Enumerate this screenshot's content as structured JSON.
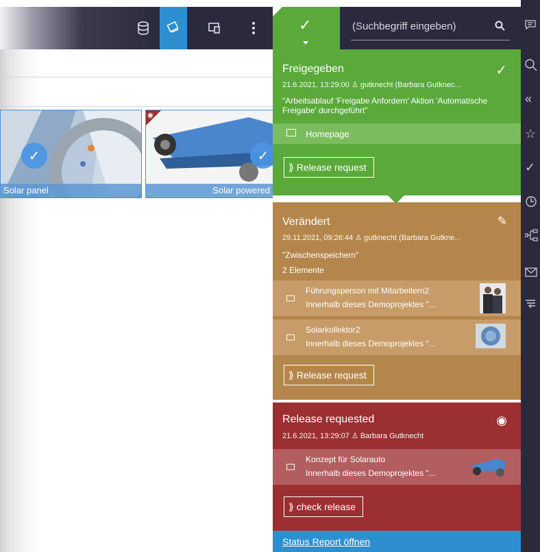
{
  "toolbar": {
    "icons": [
      "database-icon",
      "sync-icon",
      "devices-icon",
      "more-vertical-icon"
    ]
  },
  "search": {
    "placeholder": "(Suchbegriff eingeben)",
    "icon": "search-icon"
  },
  "thumbnails": [
    {
      "caption": "Solar panel",
      "selected": true
    },
    {
      "caption": "Solar powered",
      "selected": true
    }
  ],
  "status_panel": {
    "approved": {
      "title": "Freigegeben",
      "meta": "21.6.2021, 13:29:00",
      "user": "gutknecht (Barbara Gutknec...",
      "note": "\"Arbeitsablauf 'Freigabe Anfordern' Aktion 'Automatische Freigabe' durchgeführt\"",
      "folder": "Homepage",
      "button": "Release request",
      "color": "#5aa93a"
    },
    "changed": {
      "title": "Verändert",
      "meta": "29.11.2021, 09:26:44",
      "user": "gutknecht (Barbara Gutkne...",
      "note": "\"Zwischenspeichern\"",
      "count": "2 Elemente",
      "items": [
        {
          "name": "Führungsperson mit Mitarbeitern2",
          "desc": "Innerhalb dieses Demoprojektes \"..."
        },
        {
          "name": "Solarkollektor2",
          "desc": "Innerhalb dieses Demoprojektes \"..."
        }
      ],
      "button": "Release request",
      "color": "#b5864b"
    },
    "requested": {
      "title": "Release requested",
      "meta": "21.6.2021, 13:29:07",
      "user": "Barbara Gutknecht",
      "items": [
        {
          "name": "Konzept für Solarauto",
          "desc": "Innerhalb dieses Demoprojektes \"..."
        }
      ],
      "button": "check release",
      "color": "#9b2f31"
    },
    "footer_link": "Status Report öffnen",
    "footer_color": "#2d8fd0"
  },
  "rightbar": {
    "icons": [
      "comment-icon",
      "search-icon",
      "collapse-icon",
      "star-icon",
      "check-icon",
      "history-icon",
      "workflow-icon",
      "mail-icon",
      "filter-icon"
    ]
  }
}
